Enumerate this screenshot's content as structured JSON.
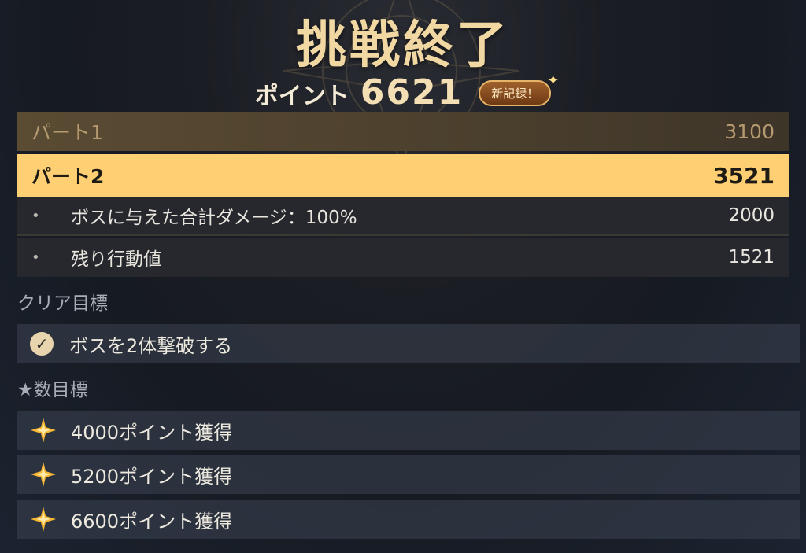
{
  "header": {
    "title": "挑戦終了",
    "score_label": "ポイント",
    "score_value": "6621",
    "badge": "新記録！"
  },
  "parts": [
    {
      "label": "パート1",
      "value": "3100"
    },
    {
      "label": "パート2",
      "value": "3521"
    }
  ],
  "breakdown": [
    {
      "label": "ボスに与えた合計ダメージ：100%",
      "value": "2000"
    },
    {
      "label": "残り行動値",
      "value": "1521"
    }
  ],
  "clear_section": {
    "title": "クリア目標",
    "items": [
      {
        "label": "ボスを2体撃破する"
      }
    ]
  },
  "star_section": {
    "title": "★数目標",
    "items": [
      {
        "label": "4000ポイント獲得"
      },
      {
        "label": "5200ポイント獲得"
      },
      {
        "label": "6600ポイント獲得"
      }
    ]
  },
  "colors": {
    "accent_gold": "#ffcf73",
    "title_gold": "#f1d8a3"
  }
}
